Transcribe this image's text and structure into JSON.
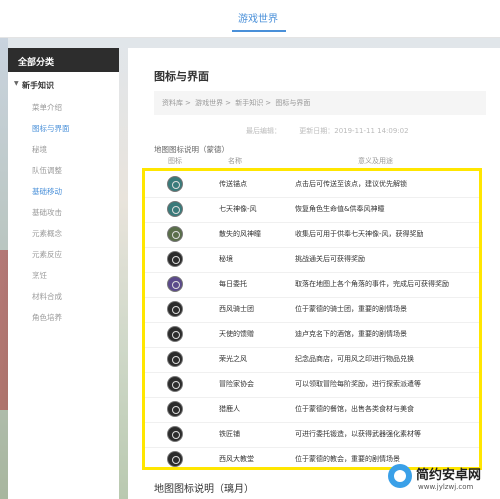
{
  "topbar": {
    "nav_label": "游戏世界"
  },
  "sidebar": {
    "header": "全部分类",
    "group": "新手知识",
    "items": [
      {
        "label": "菜单介绍",
        "active": false
      },
      {
        "label": "图标与界面",
        "active": true
      },
      {
        "label": "秘境",
        "active": false
      },
      {
        "label": "队伍调整",
        "active": false
      },
      {
        "label": "基础移动",
        "active": true
      },
      {
        "label": "基础攻击",
        "active": false
      },
      {
        "label": "元素概念",
        "active": false
      },
      {
        "label": "元素反应",
        "active": false
      },
      {
        "label": "烹饪",
        "active": false
      },
      {
        "label": "材料合成",
        "active": false
      },
      {
        "label": "角色培养",
        "active": false
      }
    ]
  },
  "main": {
    "title": "图标与界面",
    "breadcrumb": [
      "资料库",
      "游戏世界",
      "新手知识",
      "图标与界面"
    ],
    "meta": {
      "editor": "最后编辑：",
      "updated": "更新日期：2019-11-11 14:09:02"
    },
    "section_title": "地图图标说明（蒙德）",
    "columns": [
      "图标",
      "名称",
      "意义及用途"
    ],
    "rows": [
      {
        "icon": "teleport-waypoint-icon",
        "name": "传送锚点",
        "desc": "点击后可传送至该点，建议优先解锁"
      },
      {
        "icon": "statue-of-seven-icon",
        "name": "七天神像-风",
        "desc": "恢复角色生命值&供奉风神瞳"
      },
      {
        "icon": "anemoculus-icon",
        "name": "散失的风神瞳",
        "desc": "收集后可用于供奉七天神像-风，获得奖励"
      },
      {
        "icon": "domain-icon",
        "name": "秘境",
        "desc": "挑战通关后可获得奖励"
      },
      {
        "icon": "daily-commission-icon",
        "name": "每日委托",
        "desc": "取落在地图上各个角落的事件，完成后可获得奖励"
      },
      {
        "icon": "knights-icon",
        "name": "西风骑士团",
        "desc": "位于蒙德的骑士团，重要的剧情场景"
      },
      {
        "icon": "angels-share-icon",
        "name": "天使的馈赠",
        "desc": "迪卢克名下的酒馆，重要的剧情场景"
      },
      {
        "icon": "glory-wind-icon",
        "name": "荣光之风",
        "desc": "纪念品商店，可用风之印进行物品兑换"
      },
      {
        "icon": "adventurers-guild-icon",
        "name": "冒险家协会",
        "desc": "可以领取冒险每阶奖励，进行探索派遣等"
      },
      {
        "icon": "hunter-icon",
        "name": "猎鹿人",
        "desc": "位于蒙德的餐馆，出售各类食材与美食"
      },
      {
        "icon": "blacksmith-icon",
        "name": "铁匠铺",
        "desc": "可进行委托锻造，以获得武器强化素材等"
      },
      {
        "icon": "cathedral-icon",
        "name": "西风大教堂",
        "desc": "位于蒙德的教会，重要的剧情场景"
      }
    ],
    "bottom_title": "地图图标说明（璃月）"
  },
  "watermark": {
    "title": "简约安卓网",
    "url": "www.jylzwj.com"
  },
  "colors": {
    "accent": "#4a90d9",
    "highlight_box": "#ffe600",
    "sidebar_header_bg": "#2d2d2d"
  }
}
